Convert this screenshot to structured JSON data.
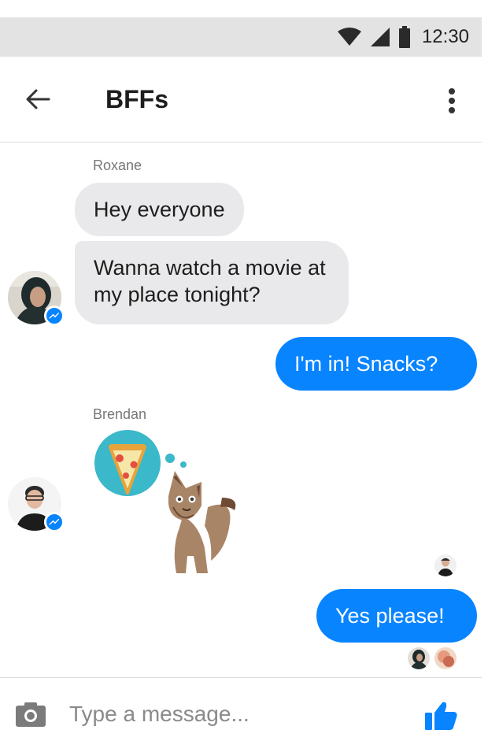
{
  "status_bar": {
    "time": "12:30",
    "icons": [
      "wifi-icon",
      "cell-signal-icon",
      "battery-icon"
    ]
  },
  "header": {
    "title": "BFFs",
    "icons": [
      "arrow-left-icon",
      "more-vertical-icon"
    ]
  },
  "messages": [
    {
      "sender": "Roxane",
      "direction": "incoming",
      "bubbles": [
        "Hey everyone",
        "Wanna watch a movie at my place tonight?"
      ]
    },
    {
      "direction": "outgoing",
      "text": "I'm in! Snacks?"
    },
    {
      "sender": "Brendan",
      "direction": "incoming",
      "sticker": "pizza-thinking-fox-sticker"
    },
    {
      "direction": "outgoing",
      "text": "Yes please!"
    }
  ],
  "composer": {
    "placeholder": "Type a message...",
    "icons": [
      "camera-icon",
      "thumbs-up-icon"
    ]
  },
  "colors": {
    "accent": "#0984ff",
    "incoming_bubble": "#e9e9eb",
    "status_bar": "#e3e3e3"
  }
}
